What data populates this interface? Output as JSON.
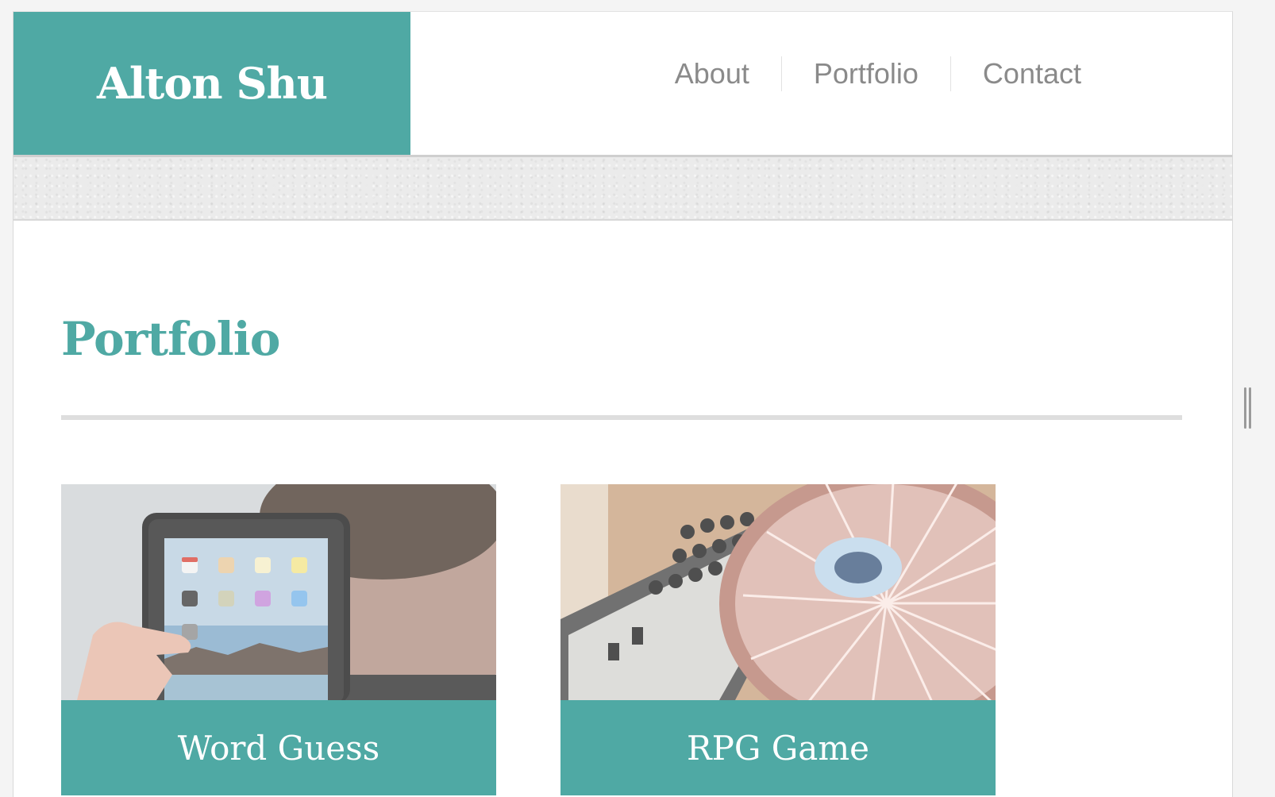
{
  "site": {
    "brand": "Alton Shu"
  },
  "nav": {
    "items": [
      "About",
      "Portfolio",
      "Contact"
    ]
  },
  "portfolio": {
    "heading": "Portfolio",
    "cards": [
      {
        "title": "Word Guess",
        "image": "ipad-photo"
      },
      {
        "title": "RPG Game",
        "image": "turntable-photo"
      }
    ]
  },
  "colors": {
    "accent": "#4fa9a4",
    "nav_text": "#8a8a8a",
    "divider": "#dedede"
  }
}
